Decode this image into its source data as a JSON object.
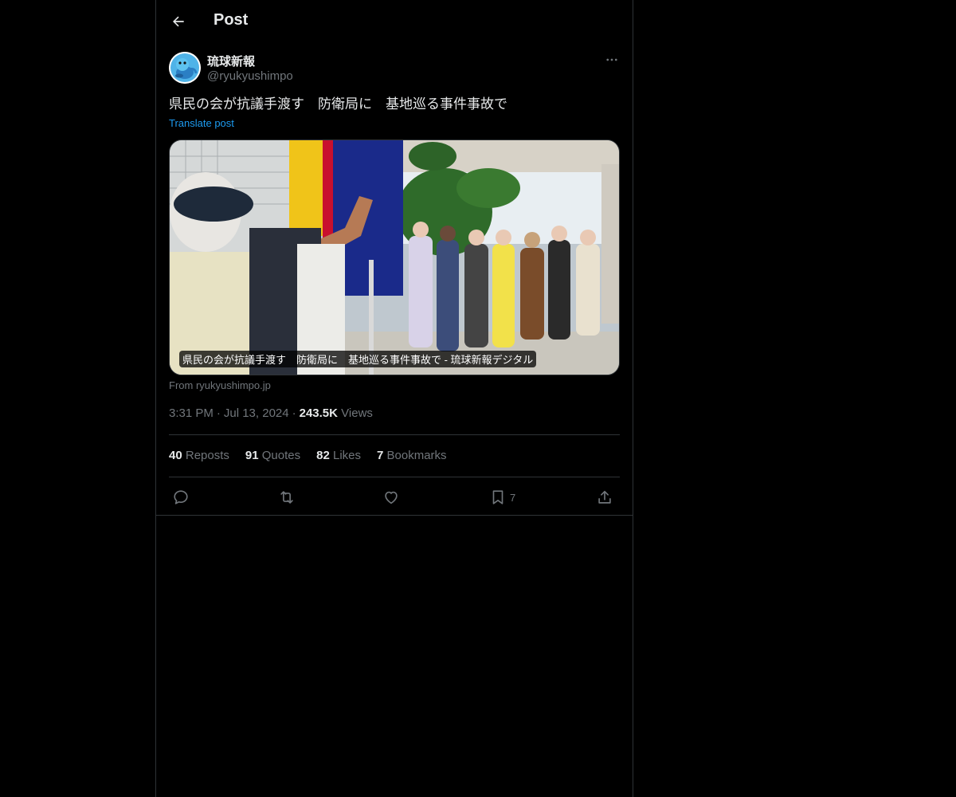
{
  "header": {
    "title": "Post",
    "back_icon": "arrow-left-icon"
  },
  "author": {
    "name": "琉球新報",
    "handle": "@ryukyushimpo",
    "avatar_icon": "mascot-avatar",
    "more_icon": "more-horizontal-icon"
  },
  "post": {
    "text": "県民の会が抗議手渡す　防衛局に　基地巡る事件事故で",
    "translate_label": "Translate post"
  },
  "card": {
    "caption": "県民の会が抗議手渡す　防衛局に　基地巡る事件事故で - 琉球新報デジタル",
    "source": "From ryukyushimpo.jp"
  },
  "meta": {
    "time": "3:31 PM",
    "date": "Jul 13, 2024",
    "views_count": "243.5K",
    "views_label": "Views"
  },
  "stats": {
    "reposts_count": "40",
    "reposts_label": "Reposts",
    "quotes_count": "91",
    "quotes_label": "Quotes",
    "likes_count": "82",
    "likes_label": "Likes",
    "bookmarks_count": "7",
    "bookmarks_label": "Bookmarks"
  },
  "actions": {
    "reply_icon": "reply-icon",
    "repost_icon": "repost-icon",
    "like_icon": "heart-icon",
    "bookmark_icon": "bookmark-icon",
    "bookmark_count": "7",
    "share_icon": "share-icon"
  },
  "colors": {
    "background": "#000000",
    "text": "#e7e9ea",
    "muted": "#71767b",
    "link": "#1d9bf0",
    "border": "#2f3336"
  }
}
